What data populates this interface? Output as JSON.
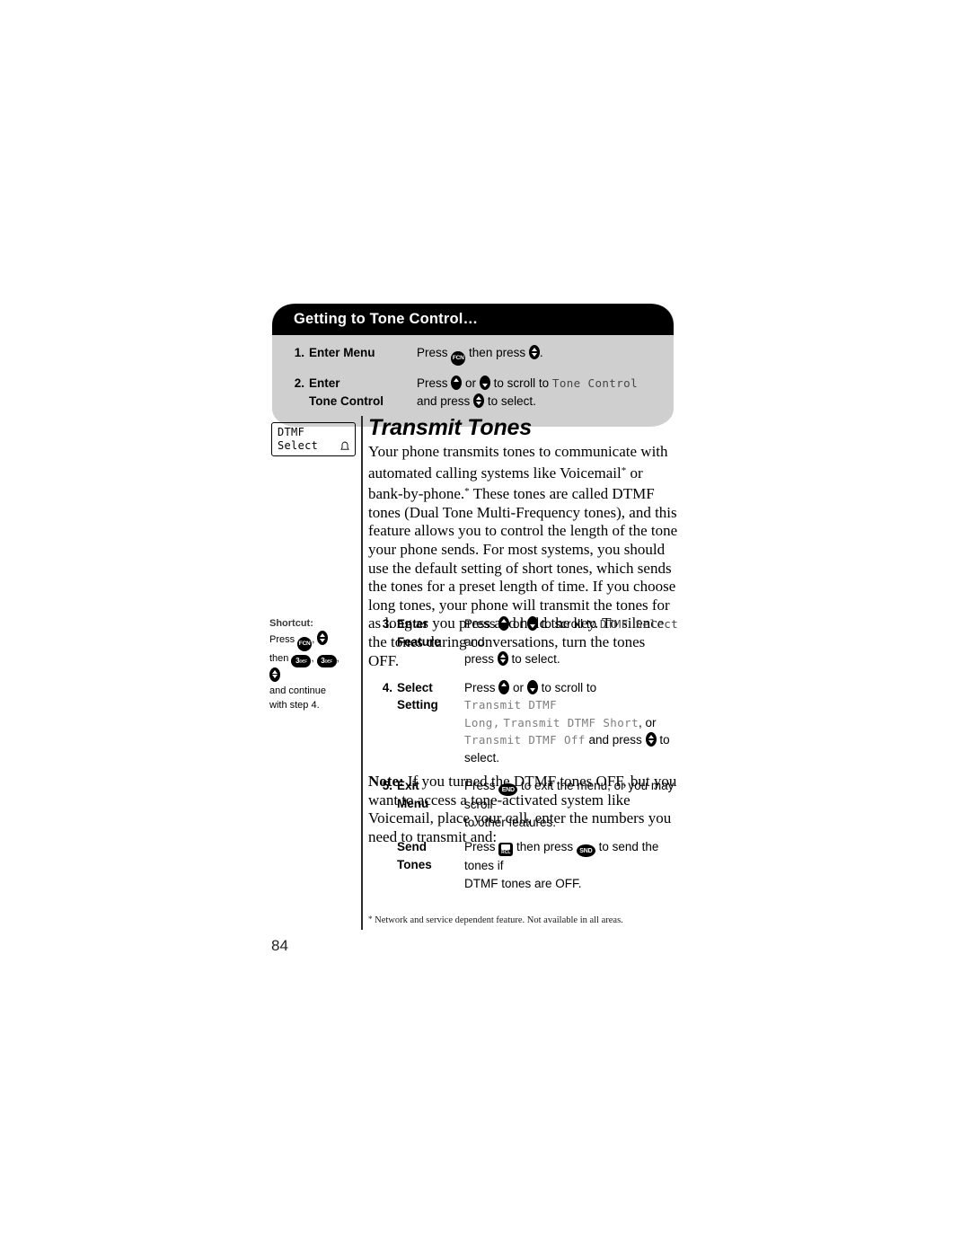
{
  "page": {
    "number": "84"
  },
  "callout": {
    "header": "Getting to Tone Control…",
    "steps": [
      {
        "num": "1.",
        "label_line1": "Enter Menu",
        "label_line2": "",
        "desc_pre": "Press",
        "key1": "FCN",
        "desc_mid": "then press",
        "key2": "select",
        "desc_post": "."
      },
      {
        "num": "2.",
        "label_line1": "Enter",
        "label_line2": "Tone Control",
        "desc_pre": "Press",
        "desc_or": "or",
        "desc_scroll": "to scroll to",
        "lcd_value": "Tone Control",
        "desc_line2_pre": "and press",
        "desc_line2_post": "to select."
      }
    ]
  },
  "lcd_screen": {
    "line1": "DTMF",
    "line2": "Select",
    "icon": "bell-icon"
  },
  "main": {
    "title": "Transmit Tones",
    "body_segments": [
      "Your phone transmits tones to communicate with automated calling systems like Voicemail",
      " or bank-by-phone.",
      " These tones are called DTMF tones (Dual Tone Multi-Frequency tones), and this feature allows you to control the length of the tone your phone sends. For most systems, you should use the default setting of short tones, which sends the tones for a preset length of time. If you choose long tones, your phone will transmit the tones for as long as you press and hold the key. To silence the tones during conversations, turn the tones OFF."
    ],
    "asterisk": "*"
  },
  "steps": [
    {
      "num": "3.",
      "label_line1": "Enter",
      "label_line2": "Feature",
      "l1_pre": "Press",
      "l1_or": "or",
      "l1_scroll": "to scroll to",
      "l1_lcd": "DTMF Select",
      "l1_tail": "and",
      "l2_pre": "press",
      "l2_post": "to select."
    },
    {
      "num": "4.",
      "label_line1": "Select",
      "label_line2": "Setting",
      "l1_pre": "Press",
      "l1_or": "or",
      "l1_scroll": "to scroll to",
      "l1_lcd": "Transmit DTMF",
      "l2_lcd_a": "Long,",
      "l2_lcd_b": "Transmit DTMF Short",
      "l2_tail": ", or",
      "l3_lcd": "Transmit DTMF Off",
      "l3_pre": "and press",
      "l3_post": "to select."
    },
    {
      "num": "5.",
      "label_line1": "Exit",
      "label_line2": "Menu",
      "l1_pre": "Press",
      "key": "END",
      "l1_post": "to exit the menu, or you may scroll",
      "l2": "to other features."
    }
  ],
  "note": {
    "label": "Note:",
    "text": " If you turned the DTMF tones OFF, but you want to access a tone-activated system like Voicemail, place your call, enter the numbers you need to transmit and:"
  },
  "send_tones": {
    "label_line1": "Send",
    "label_line2": "Tones",
    "l1_pre": "Press",
    "key1": "RCL",
    "l1_mid": "then press",
    "key2": "SND",
    "l1_post": "to send the tones if",
    "l2": "DTMF tones are OFF."
  },
  "footnote": {
    "marker": "*",
    "text": "Network and service dependent feature. Not available in all areas."
  },
  "shortcut": {
    "title": "Shortcut:",
    "line1_pre": "Press",
    "key_fcn": "FCN",
    "line2_pre": "then",
    "key_num1": "3",
    "key_num1_sub": "DEF",
    "key_num2": "3",
    "key_num2_sub": "DEF",
    "line3": "and continue",
    "line4": "with step 4."
  },
  "colors": {
    "header_bg": "#000000",
    "callout_bg": "#cfcfcf",
    "lcd_text": "#7d7d7d",
    "page_bg": "#ffffff"
  }
}
